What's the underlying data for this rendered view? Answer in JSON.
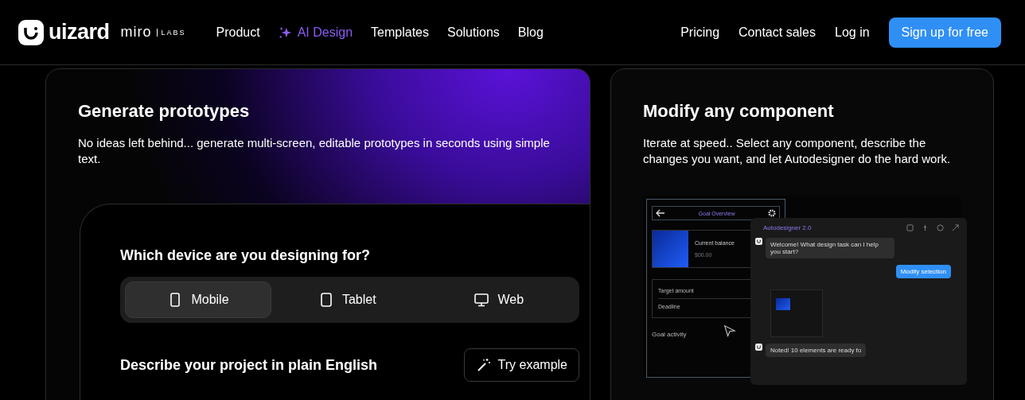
{
  "header": {
    "logo": "uizard",
    "partner": "miro",
    "partner_tag": "LABS",
    "nav": [
      {
        "label": "Product",
        "selected": false,
        "kind": "plain"
      },
      {
        "label": "AI Design",
        "selected": true,
        "kind": "sparkle"
      },
      {
        "label": "Templates",
        "selected": false,
        "kind": "plain"
      },
      {
        "label": "Solutions",
        "selected": false,
        "kind": "plain"
      },
      {
        "label": "Blog",
        "selected": false,
        "kind": "plain"
      }
    ],
    "right_links": [
      "Pricing",
      "Contact sales",
      "Log in"
    ],
    "cta": "Sign up for free"
  },
  "cards": [
    {
      "title": "Generate prototypes",
      "description": "No ideas left behind... generate multi-screen, editable prototypes in seconds using simple text.",
      "demo": {
        "question": "Which device are you designing for?",
        "devices": [
          {
            "label": "Mobile",
            "kind": "phone",
            "selected": true
          },
          {
            "label": "Tablet",
            "kind": "tablet",
            "selected": false
          },
          {
            "label": "Web",
            "kind": "monitor",
            "selected": false
          }
        ],
        "prompt_label": "Describe your project in plain English",
        "example_button": "Try example"
      }
    },
    {
      "title": "Modify any component",
      "description": "Iterate at speed.. Select any component, describe the changes you want, and let Autodesigner do the hard work.",
      "preview": {
        "screen_title": "Goal Overview",
        "balance_label": "Current balance",
        "balance_value": "$00.00",
        "fields": [
          "Target amount",
          "Deadline"
        ],
        "activity_title": "Goal activity",
        "chat_title": "Autodesigner 2.0",
        "messages": [
          {
            "text": "Welcome! What design task can I help you start?",
            "kind": "bot"
          },
          {
            "text": "Modify selection",
            "kind": "user"
          },
          {
            "text": "Noted! 10 elements are ready fo",
            "kind": "bot"
          }
        ]
      }
    }
  ]
}
